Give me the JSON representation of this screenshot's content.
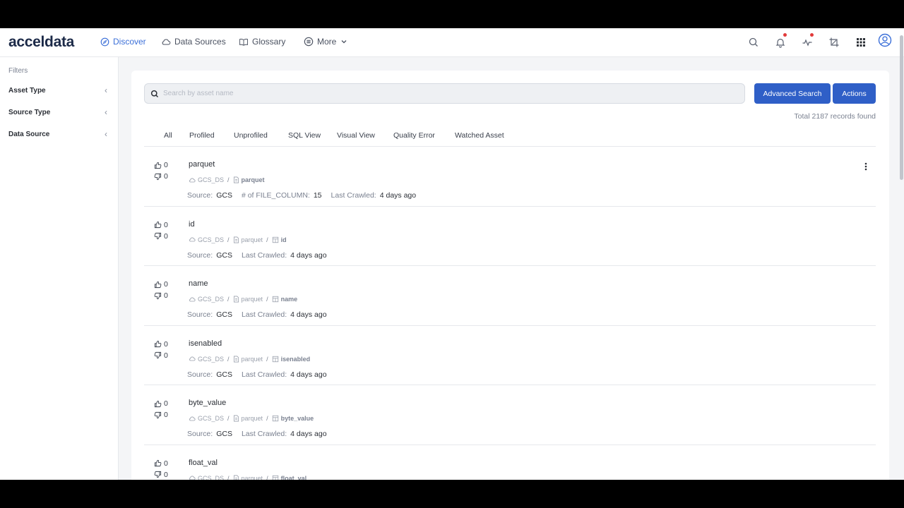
{
  "app": {
    "logo": "acceldata"
  },
  "nav": {
    "items": [
      {
        "label": "Discover",
        "icon": "compass-icon"
      },
      {
        "label": "Data Sources",
        "icon": "cloud-icon"
      },
      {
        "label": "Glossary",
        "icon": "book-icon"
      },
      {
        "label": "More",
        "icon": "list-circle-icon"
      }
    ],
    "active": "Discover",
    "right_icons": [
      "search-icon",
      "bell-icon",
      "activity-icon",
      "crop-icon",
      "apps-grid-icon",
      "user-icon"
    ]
  },
  "sidebar": {
    "title": "Filters",
    "filters": [
      {
        "label": "Asset Type"
      },
      {
        "label": "Source Type"
      },
      {
        "label": "Data Source"
      }
    ]
  },
  "search": {
    "placeholder": "Search by asset name",
    "value": ""
  },
  "buttons": {
    "advanced_search": "Advanced Search",
    "actions": "Actions"
  },
  "total_text": "Total 2187 records found",
  "tabs": [
    "All",
    "Profiled",
    "Unprofiled",
    "SQL View",
    "Visual View",
    "Quality Error",
    "Watched Asset"
  ],
  "assets": [
    {
      "name": "parquet",
      "up": "0",
      "down": "0",
      "path": [
        "GCS_DS",
        "parquet"
      ],
      "meta": [
        {
          "k": "Source:",
          "v": "GCS"
        },
        {
          "k": "# of FILE_COLUMN:",
          "v": "15"
        },
        {
          "k": "Last Crawled:",
          "v": "4 days ago"
        }
      ],
      "menu": true
    },
    {
      "name": "id",
      "up": "0",
      "down": "0",
      "path": [
        "GCS_DS",
        "parquet",
        "id"
      ],
      "meta": [
        {
          "k": "Source:",
          "v": "GCS"
        },
        {
          "k": "Last Crawled:",
          "v": "4 days ago"
        }
      ]
    },
    {
      "name": "name",
      "up": "0",
      "down": "0",
      "path": [
        "GCS_DS",
        "parquet",
        "name"
      ],
      "meta": [
        {
          "k": "Source:",
          "v": "GCS"
        },
        {
          "k": "Last Crawled:",
          "v": "4 days ago"
        }
      ]
    },
    {
      "name": "isenabled",
      "up": "0",
      "down": "0",
      "path": [
        "GCS_DS",
        "parquet",
        "isenabled"
      ],
      "meta": [
        {
          "k": "Source:",
          "v": "GCS"
        },
        {
          "k": "Last Crawled:",
          "v": "4 days ago"
        }
      ]
    },
    {
      "name": "byte_value",
      "up": "0",
      "down": "0",
      "path": [
        "GCS_DS",
        "parquet",
        "byte_value"
      ],
      "meta": [
        {
          "k": "Source:",
          "v": "GCS"
        },
        {
          "k": "Last Crawled:",
          "v": "4 days ago"
        }
      ]
    },
    {
      "name": "float_val",
      "up": "0",
      "down": "0",
      "path": [
        "GCS_DS",
        "parquet",
        "float_val"
      ],
      "meta": []
    }
  ],
  "colors": {
    "primary": "#2f5fc7",
    "active_nav": "#3b6fd8",
    "badge": "#e23b3b"
  }
}
